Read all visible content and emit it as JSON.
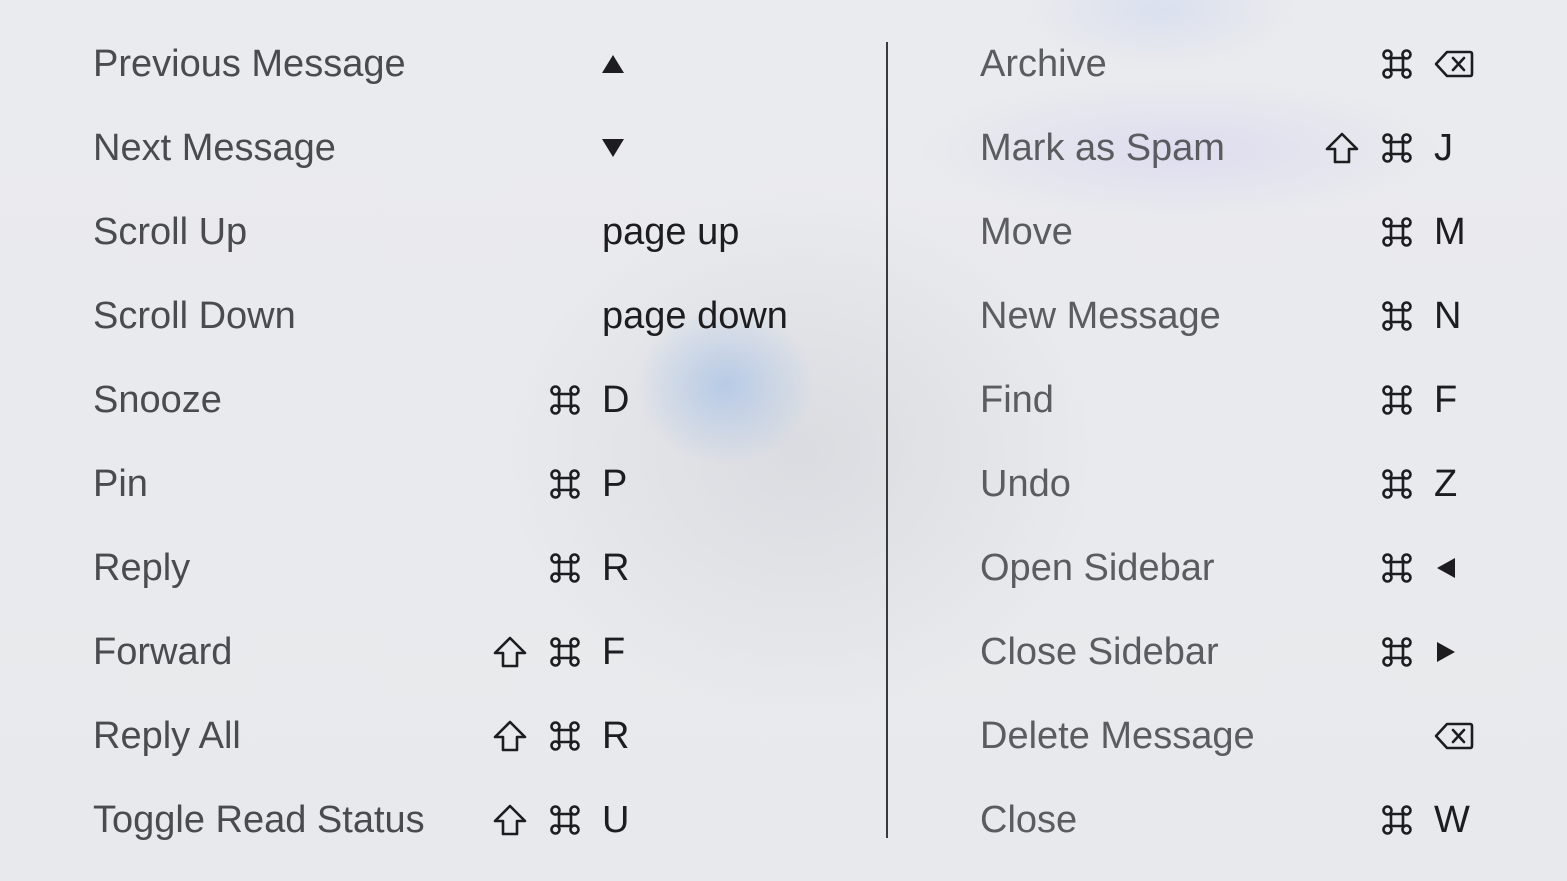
{
  "left": [
    {
      "label": "Previous Message",
      "keys": [
        "up-arrow-icon"
      ]
    },
    {
      "label": "Next Message",
      "keys": [
        "down-arrow-icon"
      ]
    },
    {
      "label": "Scroll Up",
      "keys": [
        "page up"
      ]
    },
    {
      "label": "Scroll Down",
      "keys": [
        "page down"
      ]
    },
    {
      "label": "Snooze",
      "keys": [
        "command-icon",
        "D"
      ]
    },
    {
      "label": "Pin",
      "keys": [
        "command-icon",
        "P"
      ]
    },
    {
      "label": "Reply",
      "keys": [
        "command-icon",
        "R"
      ]
    },
    {
      "label": "Forward",
      "keys": [
        "shift-icon",
        "command-icon",
        "F"
      ]
    },
    {
      "label": "Reply All",
      "keys": [
        "shift-icon",
        "command-icon",
        "R"
      ]
    },
    {
      "label": "Toggle Read Status",
      "keys": [
        "shift-icon",
        "command-icon",
        "U"
      ]
    }
  ],
  "right": [
    {
      "label": "Archive",
      "keys": [
        "command-icon",
        "delete-icon"
      ]
    },
    {
      "label": "Mark as Spam",
      "keys": [
        "shift-icon",
        "command-icon",
        "J"
      ]
    },
    {
      "label": "Move",
      "keys": [
        "command-icon",
        "M"
      ]
    },
    {
      "label": "New Message",
      "keys": [
        "command-icon",
        "N"
      ]
    },
    {
      "label": "Find",
      "keys": [
        "command-icon",
        "F"
      ]
    },
    {
      "label": "Undo",
      "keys": [
        "command-icon",
        "Z"
      ]
    },
    {
      "label": "Open Sidebar",
      "keys": [
        "command-icon",
        "left-arrow-icon"
      ]
    },
    {
      "label": "Close Sidebar",
      "keys": [
        "command-icon",
        "right-arrow-icon"
      ]
    },
    {
      "label": "Delete Message",
      "keys": [
        "delete-icon"
      ]
    },
    {
      "label": "Close",
      "keys": [
        "command-icon",
        "W"
      ]
    }
  ],
  "colors": {
    "background": "#e8e9ec",
    "label_text": "#4a4b4f",
    "key_text": "#1d1d1f",
    "divider": "#3a3a3c"
  }
}
